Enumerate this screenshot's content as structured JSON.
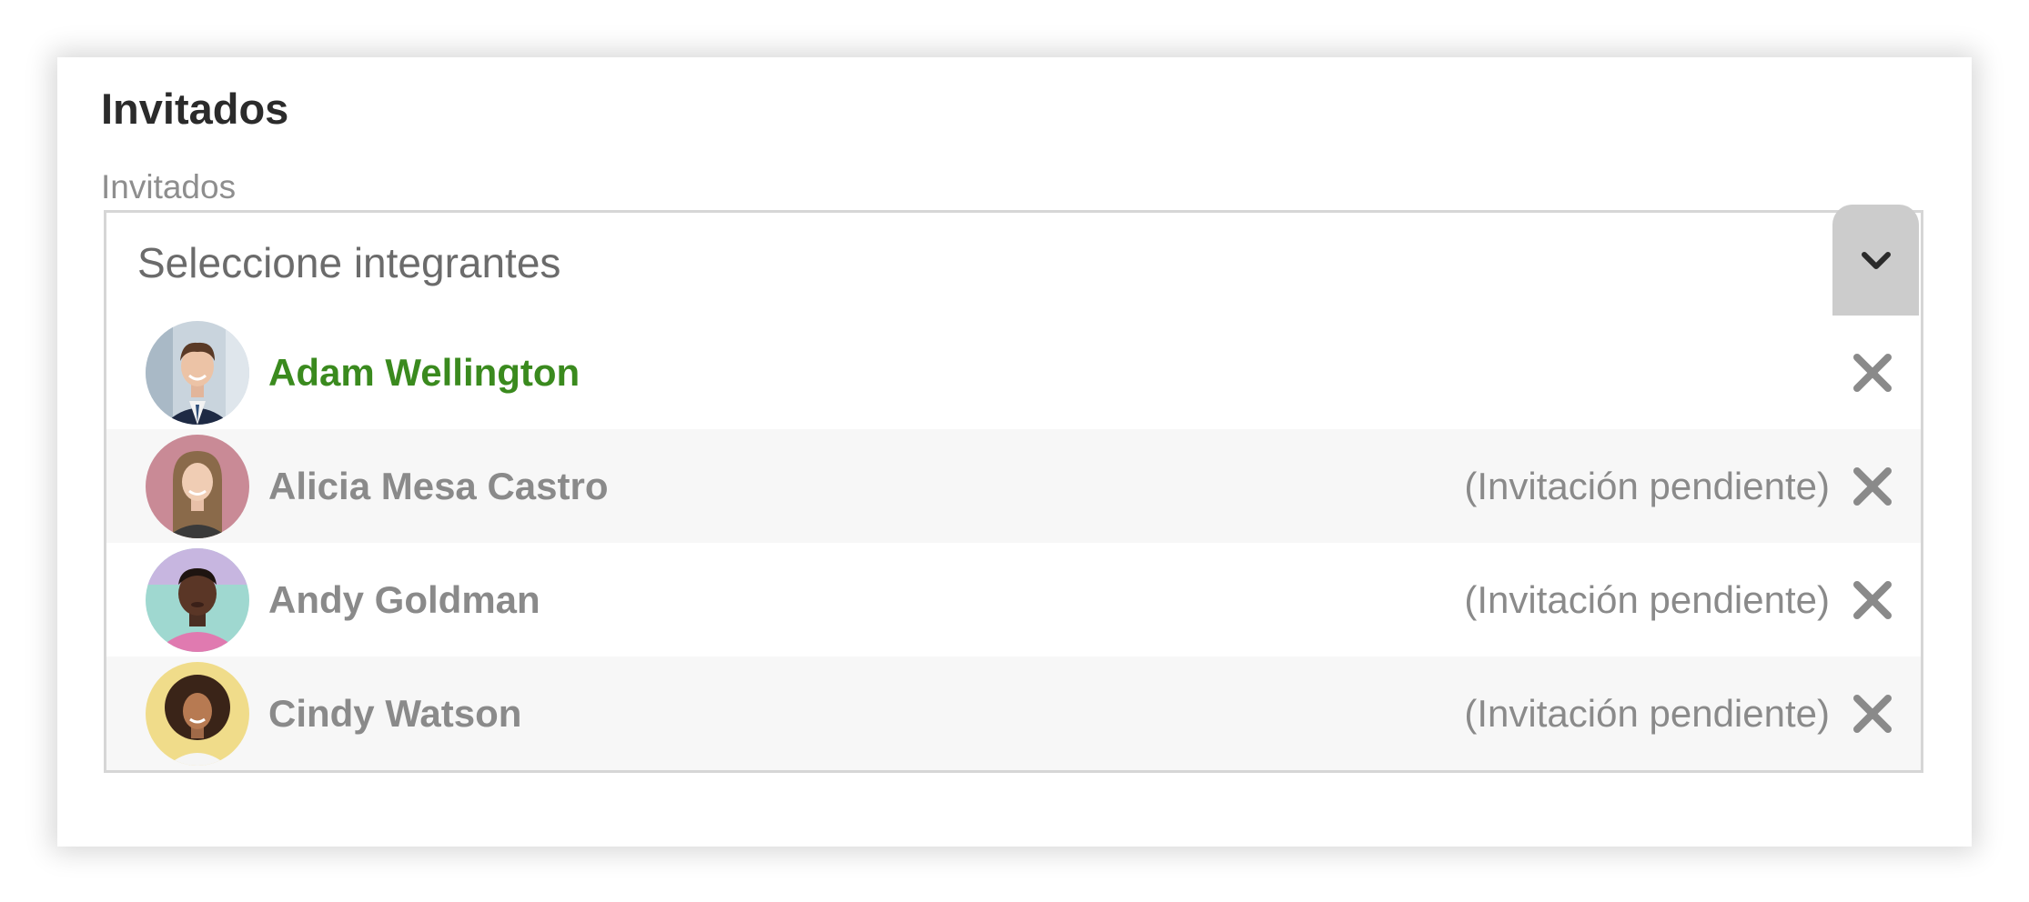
{
  "section": {
    "title": "Invitados"
  },
  "field": {
    "label": "Invitados",
    "placeholder": "Seleccione integrantes",
    "toggle_icon": "chevron-down-icon"
  },
  "members": [
    {
      "name": "Adam Wellington",
      "status": "",
      "accepted": true,
      "avatar_bg": "#c9d4dd"
    },
    {
      "name": "Alicia Mesa Castro",
      "status": "(Invitación pendiente)",
      "accepted": false,
      "avatar_bg": "#c98a96"
    },
    {
      "name": "Andy Goldman",
      "status": "(Invitación pendiente)",
      "accepted": false,
      "avatar_bg": "#9fd8d0"
    },
    {
      "name": "Cindy Watson",
      "status": "(Invitación pendiente)",
      "accepted": false,
      "avatar_bg": "#f0dc8a"
    }
  ],
  "icons": {
    "remove": "close-icon"
  },
  "colors": {
    "accepted_name": "#3a8a1e",
    "pending_text": "#8a8a8a",
    "toggle_bg": "#cccccc",
    "border": "#d6d6d6"
  }
}
